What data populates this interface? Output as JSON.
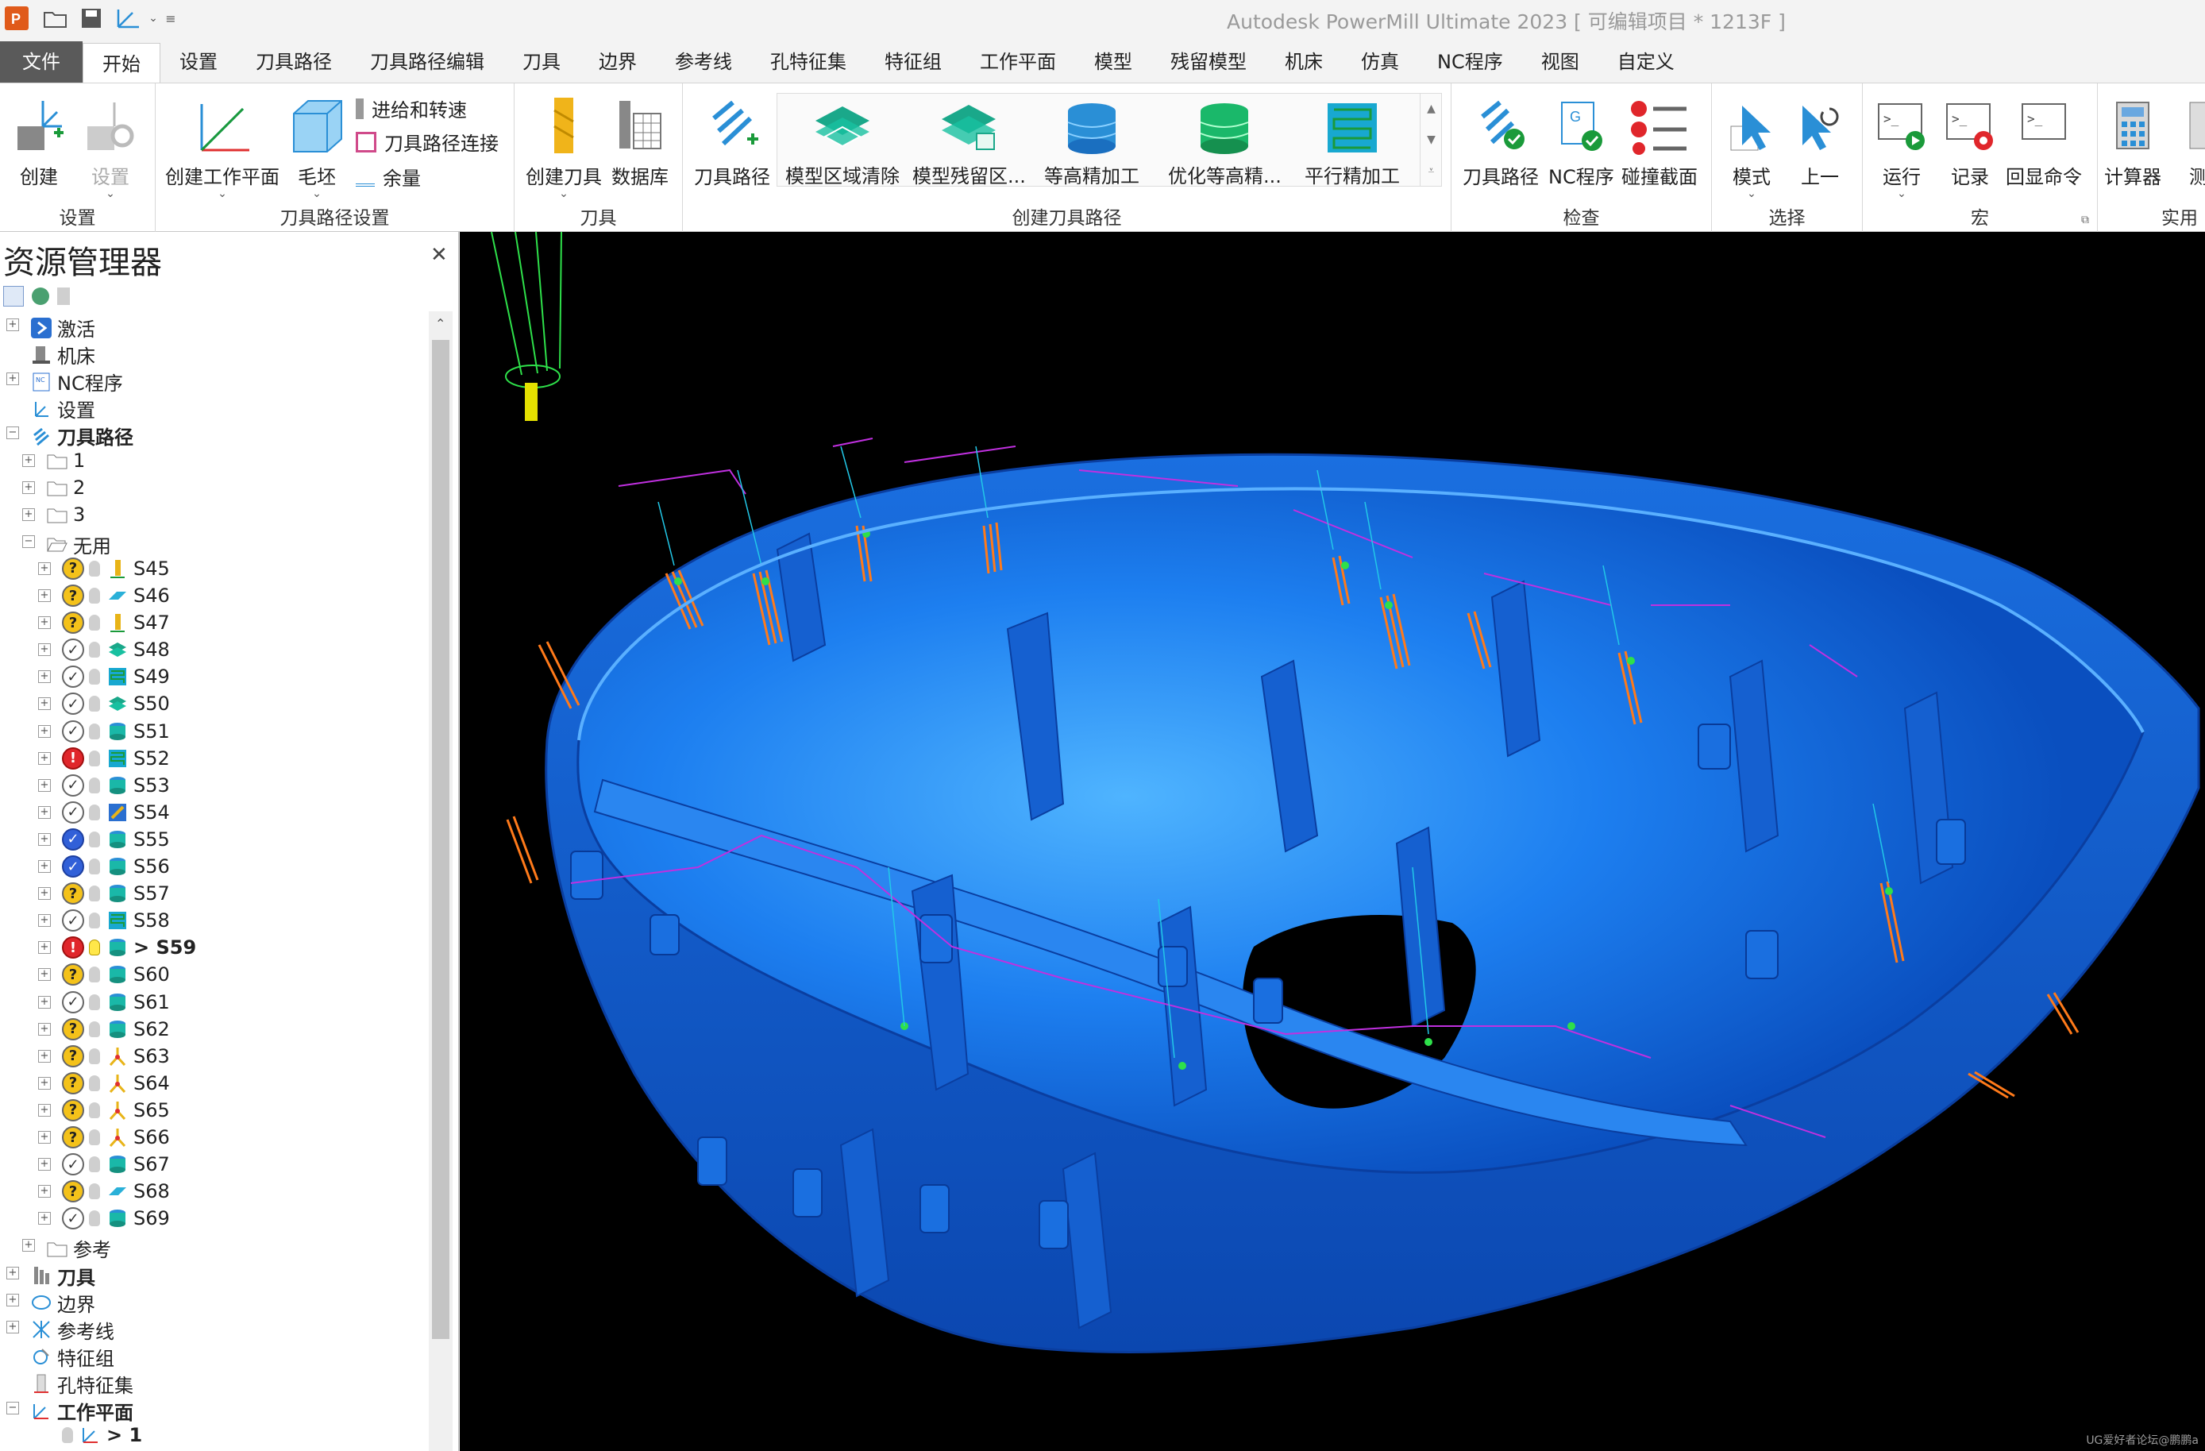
{
  "app": {
    "title": "Autodesk PowerMill Ultimate 2023    [ 可编辑项目 * 1213F ]"
  },
  "menu": {
    "file": "文件",
    "tabs": [
      "开始",
      "设置",
      "刀具路径",
      "刀具路径编辑",
      "刀具",
      "边界",
      "参考线",
      "孔特征集",
      "特征组",
      "工作平面",
      "模型",
      "残留模型",
      "机床",
      "仿真",
      "NC程序",
      "视图",
      "自定义"
    ]
  },
  "ribbon": {
    "groups": {
      "setup": {
        "label": "设置",
        "create": "创建",
        "settings": "设置"
      },
      "tp_setup": {
        "label": "刀具路径设置",
        "create_wp": "创建工作平面",
        "block": "毛坯",
        "leads": "进给和转速",
        "links": "刀具路径连接",
        "thickness": "余量"
      },
      "tool": {
        "label": "刀具",
        "create_tool": "创建刀具",
        "database": "数据库"
      },
      "create_tp": {
        "label": "创建刀具路径",
        "toolpath": "刀具路径",
        "gallery": [
          "模型区域清除",
          "模型残留区...",
          "等高精加工",
          "优化等高精...",
          "平行精加工"
        ]
      },
      "verify": {
        "label": "检查",
        "toolpath": "刀具路径",
        "ncprog": "NC程序",
        "collision": "碰撞截面"
      },
      "select": {
        "label": "选择",
        "mode": "模式",
        "prev": "上一"
      },
      "macro": {
        "label": "宏",
        "run": "运行",
        "record": "记录",
        "echo": "回显命令"
      },
      "util": {
        "label": "实用",
        "calc": "计算器",
        "measure": "测"
      }
    }
  },
  "explorer": {
    "title": "资源管理器",
    "tree": [
      {
        "label": "激活",
        "icon": "activate-icon",
        "exp": "+",
        "indent": 0
      },
      {
        "label": "机床",
        "icon": "machine-icon",
        "exp": "",
        "indent": 0
      },
      {
        "label": "NC程序",
        "icon": "nc-program-icon",
        "exp": "+",
        "indent": 0
      },
      {
        "label": "设置",
        "icon": "setup-icon",
        "exp": "",
        "indent": 0
      },
      {
        "label": "刀具路径",
        "icon": "toolpath-icon",
        "exp": "-",
        "indent": 0,
        "bold": true
      },
      {
        "label": "1",
        "icon": "folder-icon",
        "exp": "+",
        "indent": 1
      },
      {
        "label": "2",
        "icon": "folder-icon",
        "exp": "+",
        "indent": 1
      },
      {
        "label": "3",
        "icon": "folder-icon",
        "exp": "+",
        "indent": 1
      },
      {
        "label": "无用",
        "icon": "folder-open-icon",
        "exp": "-",
        "indent": 1
      },
      {
        "label": "S45",
        "st": "q",
        "tp": "drill",
        "indent": 2
      },
      {
        "label": "S46",
        "st": "q",
        "tp": "flat",
        "indent": 2
      },
      {
        "label": "S47",
        "st": "q",
        "tp": "drill",
        "indent": 2
      },
      {
        "label": "S48",
        "st": "ok",
        "tp": "layers",
        "indent": 2
      },
      {
        "label": "S49",
        "st": "ok",
        "tp": "raster",
        "indent": 2
      },
      {
        "label": "S50",
        "st": "ok",
        "tp": "layers",
        "indent": 2
      },
      {
        "label": "S51",
        "st": "ok",
        "tp": "stack",
        "indent": 2
      },
      {
        "label": "S52",
        "st": "err",
        "tp": "raster",
        "indent": 2
      },
      {
        "label": "S53",
        "st": "ok",
        "tp": "stack",
        "indent": 2
      },
      {
        "label": "S54",
        "st": "ok",
        "tp": "raster2",
        "indent": 2
      },
      {
        "label": "S55",
        "st": "act",
        "tp": "stack",
        "indent": 2
      },
      {
        "label": "S56",
        "st": "act",
        "tp": "stack",
        "indent": 2
      },
      {
        "label": "S57",
        "st": "q",
        "tp": "stack",
        "indent": 2
      },
      {
        "label": "S58",
        "st": "ok",
        "tp": "raster",
        "indent": 2
      },
      {
        "label": "> S59",
        "st": "err",
        "tp": "stack",
        "indent": 2,
        "bold": true,
        "on": true
      },
      {
        "label": "S60",
        "st": "q",
        "tp": "stack",
        "indent": 2
      },
      {
        "label": "S61",
        "st": "ok",
        "tp": "stack",
        "indent": 2
      },
      {
        "label": "S62",
        "st": "q",
        "tp": "stack",
        "indent": 2
      },
      {
        "label": "S63",
        "st": "q",
        "tp": "fork",
        "indent": 2
      },
      {
        "label": "S64",
        "st": "q",
        "tp": "fork",
        "indent": 2
      },
      {
        "label": "S65",
        "st": "q",
        "tp": "fork",
        "indent": 2
      },
      {
        "label": "S66",
        "st": "q",
        "tp": "fork",
        "indent": 2
      },
      {
        "label": "S67",
        "st": "ok",
        "tp": "stack",
        "indent": 2
      },
      {
        "label": "S68",
        "st": "q",
        "tp": "flat",
        "indent": 2
      },
      {
        "label": "S69",
        "st": "ok",
        "tp": "stack",
        "indent": 2
      },
      {
        "label": "参考",
        "icon": "folder-icon",
        "exp": "+",
        "indent": 1
      },
      {
        "label": "刀具",
        "icon": "tool-icon",
        "exp": "+",
        "indent": 0,
        "bold": true
      },
      {
        "label": "边界",
        "icon": "boundary-icon",
        "exp": "+",
        "indent": 0
      },
      {
        "label": "参考线",
        "icon": "pattern-icon",
        "exp": "+",
        "indent": 0
      },
      {
        "label": "特征组",
        "icon": "feature-icon",
        "exp": "",
        "indent": 0
      },
      {
        "label": "孔特征集",
        "icon": "hole-icon",
        "exp": "",
        "indent": 0
      },
      {
        "label": "工作平面",
        "icon": "workplane-icon",
        "exp": "-",
        "indent": 0,
        "bold": true
      },
      {
        "label": "> 1",
        "icon": "workplane-icon",
        "exp": "",
        "indent": 2,
        "bold": true,
        "on": true
      }
    ]
  },
  "viewport": {
    "watermark": "UG爱好者论坛@鹏鹏a"
  },
  "colors": {
    "accent": "#2a8fd6",
    "model_blue": "#1a6fe0",
    "ribbon_bg": "#ffffff",
    "viewport_bg": "#000000"
  }
}
